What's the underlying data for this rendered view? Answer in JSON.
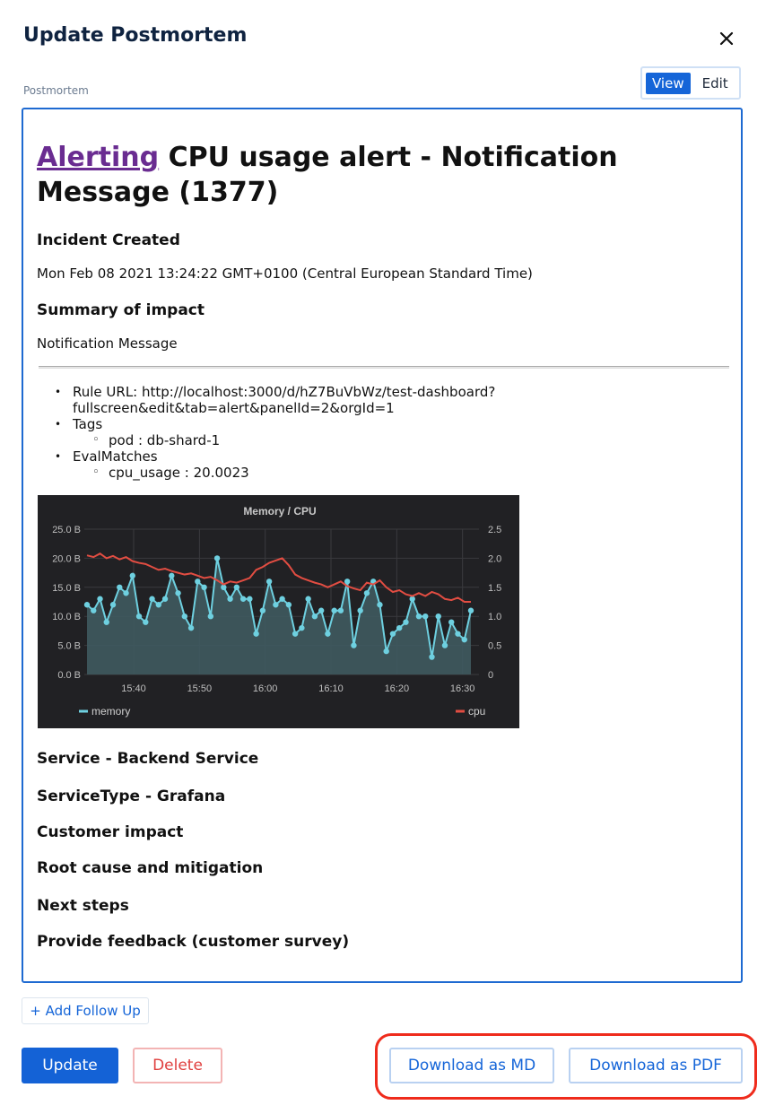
{
  "modal": {
    "title": "Update Postmortem",
    "section_label": "Postmortem",
    "view_label": "View",
    "edit_label": "Edit"
  },
  "document": {
    "title_link": "Alerting",
    "title_rest": "CPU usage alert - Notification Message (1377)",
    "incident_created_heading": "Incident Created",
    "incident_created_value": "Mon Feb 08 2021 13:24:22 GMT+0100 (Central European Standard Time)",
    "summary_heading": "Summary of impact",
    "summary_value": "Notification Message",
    "list": {
      "rule_url_line1": "Rule URL: http://localhost:3000/d/hZ7BuVbWz/test-dashboard?",
      "rule_url_line2": "fullscreen&edit&tab=alert&panelId=2&orgId=1",
      "tags_label": "Tags",
      "tag_item": "pod : db-shard-1",
      "evalmatches_label": "EvalMatches",
      "evalmatch_item": "cpu_usage : 20.0023"
    },
    "service_heading": "Service - Backend Service",
    "service_type_heading": "ServiceType - Grafana",
    "customer_impact_heading": "Customer impact",
    "root_cause_heading": "Root cause and mitigation",
    "next_steps_heading": "Next steps",
    "feedback_heading": "Provide feedback (customer survey)"
  },
  "chart_data": {
    "type": "line",
    "title": "Memory / CPU",
    "x_ticks": [
      "15:40",
      "15:50",
      "16:00",
      "16:10",
      "16:20",
      "16:30"
    ],
    "left_axis_ticks": [
      "25.0 B",
      "20.0 B",
      "15.0 B",
      "10.0 B",
      "5.0 B",
      "0.0 B"
    ],
    "right_axis_ticks": [
      "2.5",
      "2.0",
      "1.5",
      "1.0",
      "0.5",
      "0"
    ],
    "ylim_left": [
      0,
      25
    ],
    "ylim_right": [
      0,
      2.5
    ],
    "legend_placement": "bottom",
    "grid": true,
    "series": [
      {
        "name": "memory",
        "color": "#6ed0e0",
        "axis": "left",
        "values": [
          12,
          11,
          13,
          9,
          12,
          15,
          14,
          17,
          10,
          9,
          13,
          12,
          13,
          17,
          14,
          10,
          8,
          16,
          15,
          10,
          20,
          15,
          13,
          15,
          13,
          13,
          7,
          11,
          16,
          12,
          13,
          12,
          7,
          8,
          13,
          10,
          11,
          7,
          11,
          11,
          16,
          5,
          11,
          14,
          16,
          12,
          4,
          7,
          8,
          9,
          13,
          10,
          10,
          3,
          10,
          5,
          9,
          7,
          6,
          11
        ]
      },
      {
        "name": "cpu",
        "color": "#e24d42",
        "axis": "right",
        "values": [
          2.05,
          2.02,
          2.08,
          2.0,
          2.04,
          1.98,
          2.02,
          1.95,
          1.92,
          1.9,
          1.85,
          1.8,
          1.82,
          1.78,
          1.75,
          1.72,
          1.74,
          1.7,
          1.66,
          1.68,
          1.62,
          1.55,
          1.6,
          1.58,
          1.62,
          1.66,
          1.8,
          1.85,
          1.92,
          1.96,
          2.0,
          1.88,
          1.72,
          1.66,
          1.62,
          1.58,
          1.55,
          1.5,
          1.55,
          1.6,
          1.52,
          1.48,
          1.45,
          1.58,
          1.55,
          1.62,
          1.5,
          1.42,
          1.45,
          1.38,
          1.35,
          1.4,
          1.35,
          1.42,
          1.38,
          1.3,
          1.28,
          1.32,
          1.25,
          1.25
        ]
      }
    ]
  },
  "footer": {
    "add_follow_up": "+ Add Follow Up",
    "update": "Update",
    "delete": "Delete",
    "download_md": "Download as MD",
    "download_pdf": "Download as PDF"
  }
}
